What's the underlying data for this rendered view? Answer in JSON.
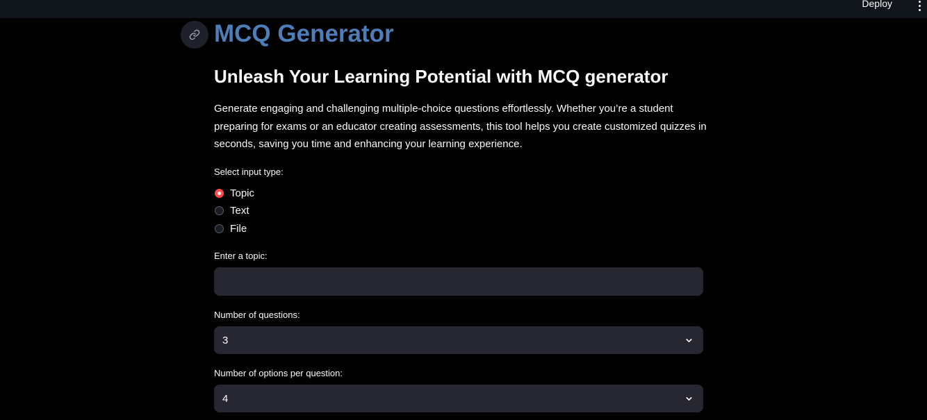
{
  "header": {
    "deploy_label": "Deploy",
    "menu_icon": "more-vertical-icon"
  },
  "page": {
    "anchor_icon": "link-icon",
    "title": "MCQ Generator",
    "subtitle": "Unleash Your Learning Potential with MCQ generator",
    "description": "Generate engaging and challenging multiple-choice questions effortlessly. Whether you’re a student preparing for exams or an educator creating assessments, this tool helps you create customized quizzes in seconds, saving you time and enhancing your learning experience."
  },
  "input_type": {
    "label": "Select input type:",
    "options": [
      {
        "label": "Topic",
        "selected": true
      },
      {
        "label": "Text",
        "selected": false
      },
      {
        "label": "File",
        "selected": false
      }
    ],
    "accent_color": "#ff4b4b"
  },
  "topic": {
    "label": "Enter a topic:",
    "value": "",
    "placeholder": ""
  },
  "num_questions": {
    "label": "Number of questions:",
    "selected": "3"
  },
  "num_options": {
    "label": "Number of options per question:",
    "selected": "4"
  },
  "colors": {
    "title": "#4e7db8",
    "background": "#000000",
    "topbar": "#11151c",
    "field": "#262730"
  }
}
